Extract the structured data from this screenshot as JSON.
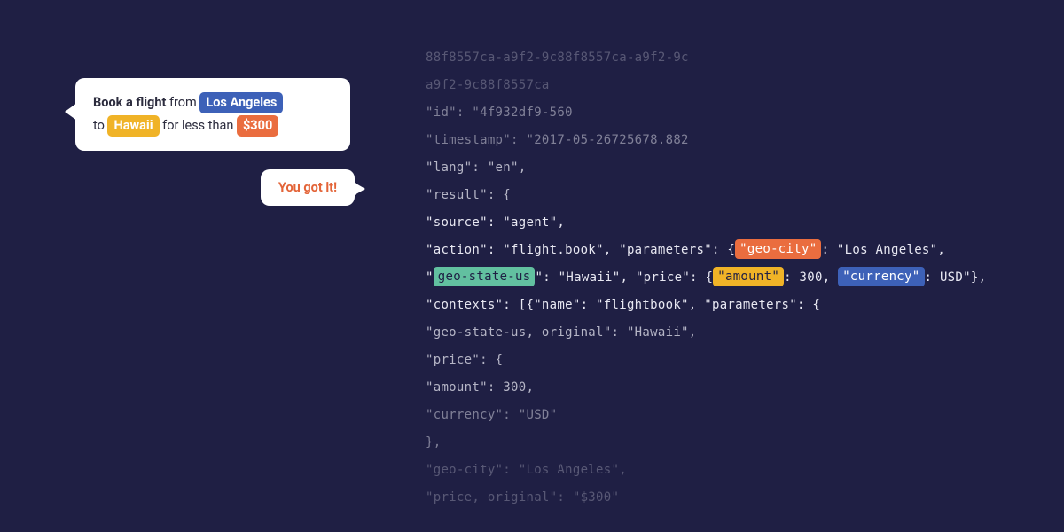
{
  "chat": {
    "user": {
      "p1_bold": "Book a flight",
      "p1_rest": " from ",
      "city": "Los Angeles",
      "p2_pre": "to ",
      "state": "Hawaii",
      "p2_mid": " for less than ",
      "price": "$300"
    },
    "bot": "You got it!"
  },
  "code": {
    "l1": "88f8557ca-a9f2-9c88f8557ca-a9f2-9c",
    "l2": "a9f2-9c88f8557ca",
    "l3": "\"id\": \"4f932df9-560",
    "l4": "\"timestamp\": \"2017-05-26725678.882",
    "l5": "\"lang\": \"en\",",
    "l6": "\"result\": {",
    "l7": "\"source\": \"agent\",",
    "l8a": "\"action\": \"flight.book\", \"parameters\": {",
    "l8_geo_city": "\"geo-city\"",
    "l8b": ": \"Los Angeles\",",
    "l9a": "\"",
    "l9_geo_state": "geo-state-us",
    "l9b": "\": \"Hawaii\", \"price\": {",
    "l9_amount": "\"amount\"",
    "l9c": ": 300, ",
    "l9_currency": "\"currency\"",
    "l9d": ": USD\"},",
    "l10": "\"contexts\": [{\"name\": \"flightbook\", \"parameters\": {",
    "l11": "\"geo-state-us, original\": \"Hawaii\",",
    "l12": "\"price\": {",
    "l13": "\"amount\": 300,",
    "l14": "\"currency\": \"USD\"",
    "l15": "},",
    "l16": "\"geo-city\": \"Los Angeles\",",
    "l17": "\"price, original\": \"$300\""
  }
}
